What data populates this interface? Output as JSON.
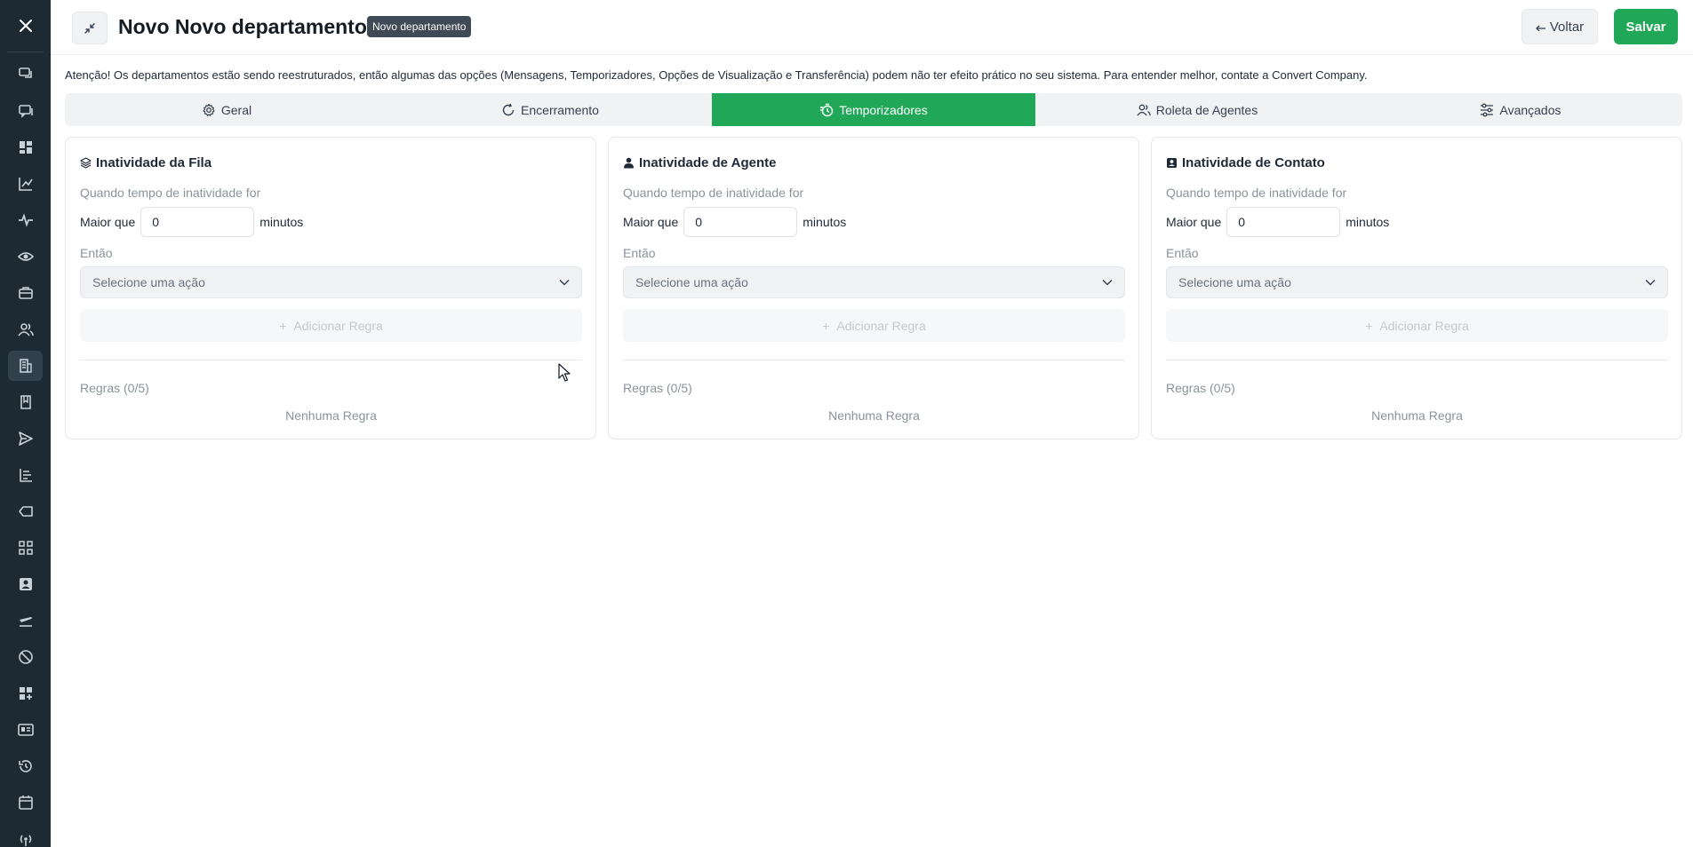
{
  "header": {
    "title": "Novo Novo departamento",
    "badge": "Novo departamento",
    "back_label": "Voltar",
    "save_label": "Salvar"
  },
  "notice": "Atenção! Os departamentos estão sendo reestruturados, então algumas das opções (Mensagens, Temporizadores, Opções de Visualização e Transferência) podem não ter efeito prático no seu sistema. Para entender melhor, contate a Convert Company.",
  "tabs": [
    {
      "label": "Geral",
      "icon": "gear-icon",
      "active": false
    },
    {
      "label": "Encerramento",
      "icon": "refresh-icon",
      "active": false
    },
    {
      "label": "Temporizadores",
      "icon": "timer-icon",
      "active": true
    },
    {
      "label": "Roleta de Agentes",
      "icon": "users-icon",
      "active": false
    },
    {
      "label": "Avançados",
      "icon": "sliders-icon",
      "active": false
    }
  ],
  "cards": [
    {
      "title": "Inatividade da Fila",
      "icon": "layers-icon",
      "condition_label": "Quando tempo de inatividade for",
      "greater_label": "Maior que",
      "minutes_value": "0",
      "unit": "minutos",
      "then_label": "Então",
      "select_placeholder": "Selecione uma ação",
      "add_rule_label": "Adicionar Regra",
      "rules_count": "Regras (0/5)",
      "empty_label": "Nenhuma Regra"
    },
    {
      "title": "Inatividade de Agente",
      "icon": "person-icon",
      "condition_label": "Quando tempo de inatividade for",
      "greater_label": "Maior que",
      "minutes_value": "0",
      "unit": "minutos",
      "then_label": "Então",
      "select_placeholder": "Selecione uma ação",
      "add_rule_label": "Adicionar Regra",
      "rules_count": "Regras (0/5)",
      "empty_label": "Nenhuma Regra"
    },
    {
      "title": "Inatividade de Contato",
      "icon": "contact-card-icon",
      "condition_label": "Quando tempo de inatividade for",
      "greater_label": "Maior que",
      "minutes_value": "0",
      "unit": "minutos",
      "then_label": "Então",
      "select_placeholder": "Selecione uma ação",
      "add_rule_label": "Adicionar Regra",
      "rules_count": "Regras (0/5)",
      "empty_label": "Nenhuma Regra"
    }
  ],
  "colors": {
    "sidebar_bg": "#1e2a33",
    "accent_green": "#21a758",
    "badge_bg": "#3f4a56"
  },
  "sidebar": {
    "active_item": "departments-icon",
    "icons": [
      "chat-icon",
      "conversations-icon",
      "dashboard-icon",
      "chart-icon",
      "activity-icon",
      "eye-icon",
      "briefcase-icon",
      "team-icon",
      "departments-icon",
      "book-icon",
      "send-icon",
      "list-icon",
      "tag-icon",
      "grid-icon",
      "contact-icon",
      "flight-icon",
      "block-icon",
      "apps-icon",
      "id-card-icon",
      "history-icon",
      "calendar-icon",
      "antenna-icon"
    ]
  }
}
